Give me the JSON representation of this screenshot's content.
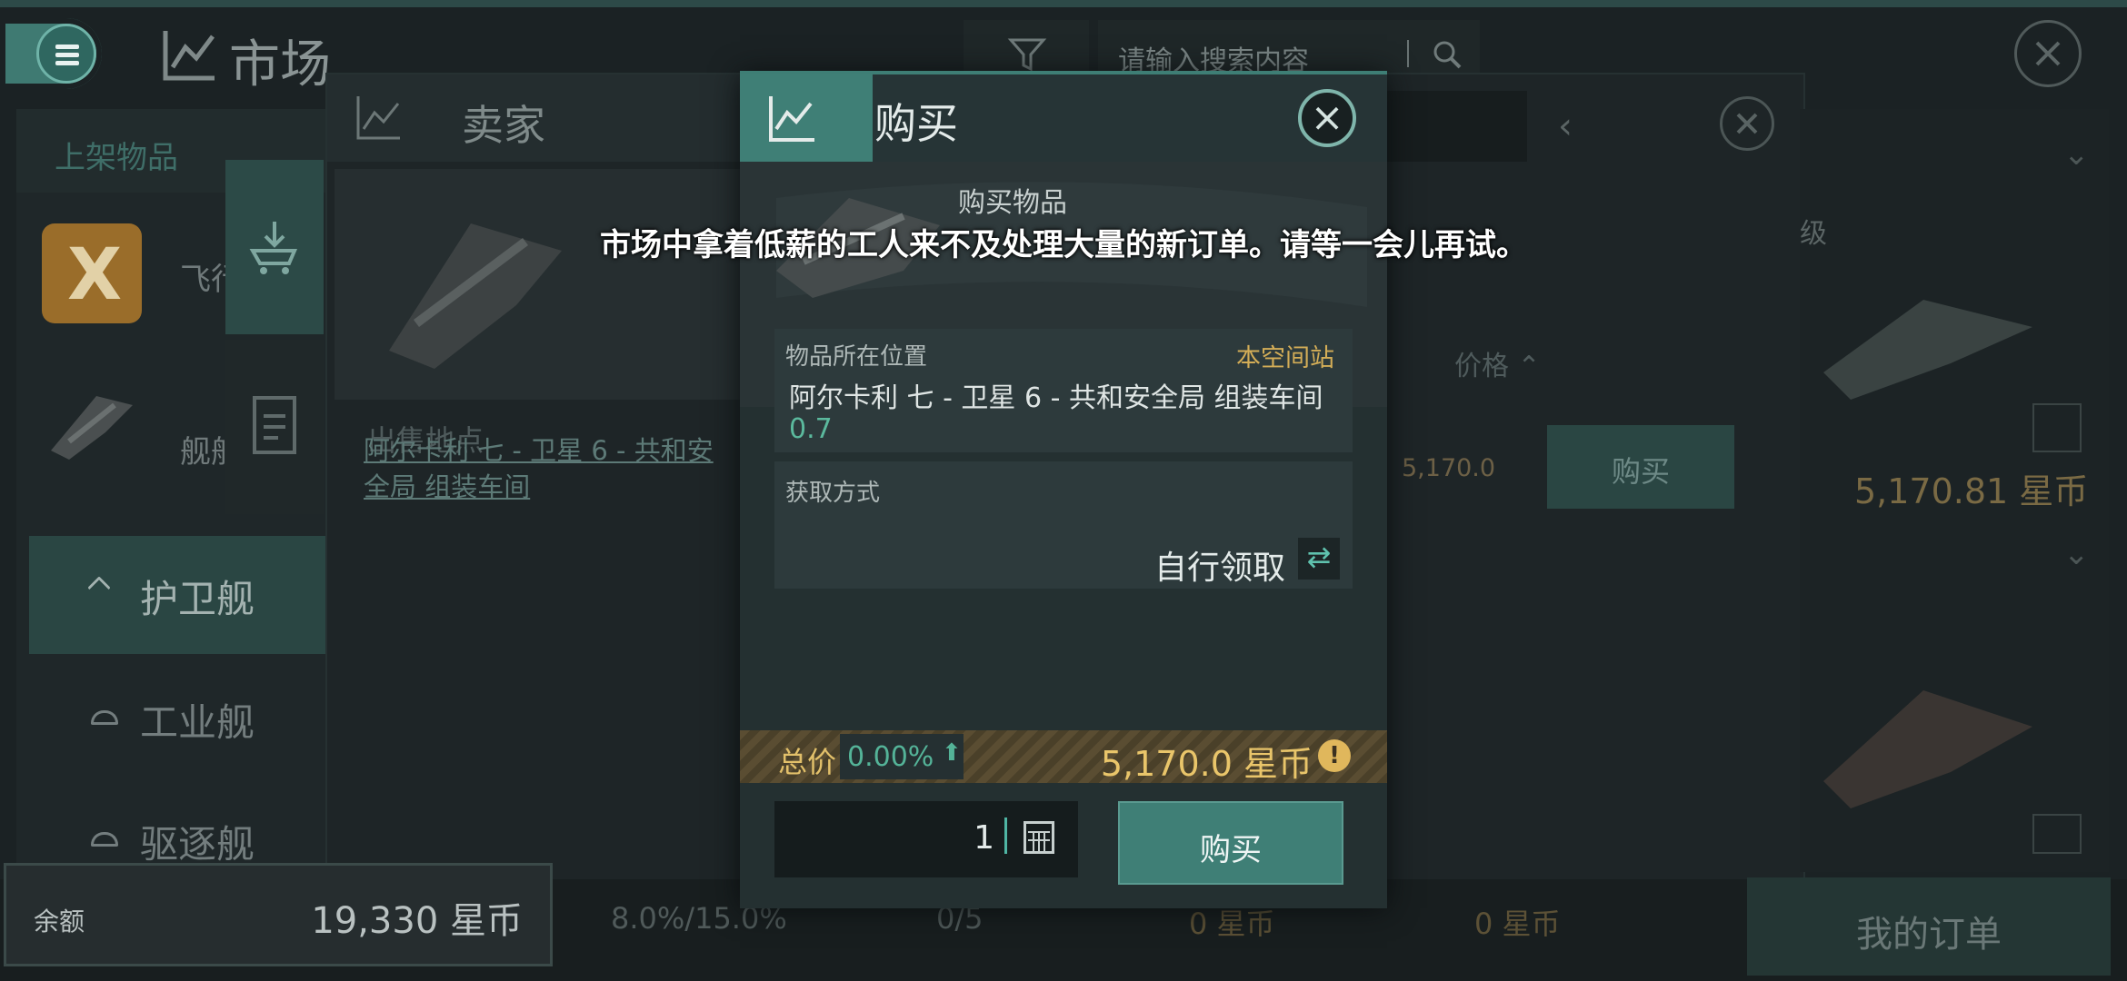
{
  "header": {
    "title": "市场",
    "search_placeholder": "请输入搜索内容"
  },
  "left_panel": {
    "header": "上架物品",
    "item1_label": "飞行",
    "item1_icon_letter": "X",
    "item2_label": "舰船",
    "categories": [
      "护卫舰",
      "工业舰",
      "驱逐舰"
    ]
  },
  "seller_window": {
    "tab_title": "卖家",
    "location_header": "出售地点",
    "price_header": "价格",
    "location": "阿尔卡利 七 - 卫星 6 - 共和安全局 组装车间",
    "price": "5,170.0",
    "buy_label": "购买"
  },
  "right_column": {
    "level_label": "级",
    "price": "5,170.81 星币"
  },
  "buy_dialog": {
    "title": "购买",
    "item_heading": "购买物品",
    "location_label": "物品所在位置",
    "station_badge": "本空间站",
    "location_text": "阿尔卡利 七 - 卫星 6 - 共和安全局 组装车间",
    "security": "0.7",
    "acquire_label": "获取方式",
    "acquire_value": "自行领取",
    "total_label": "总价",
    "total_percent": "0.00%",
    "total_price": "5,170.0 星币",
    "quantity": "1",
    "buy_button": "购买"
  },
  "toast": {
    "message": "市场中拿着低薪的工人来不及处理大量的新订单。请等一会儿再试。"
  },
  "bottom_bar": {
    "balance_label": "余额",
    "balance_value": "19,330 星币",
    "tax": "8.0%/15.0%",
    "orders": "0/5",
    "escrow1": "0 星币",
    "escrow2": "0 星币",
    "my_orders": "我的订单"
  },
  "colors": {
    "accent": "#3f7f76",
    "gold": "#e9c56a",
    "security_green": "#5bb99d"
  }
}
